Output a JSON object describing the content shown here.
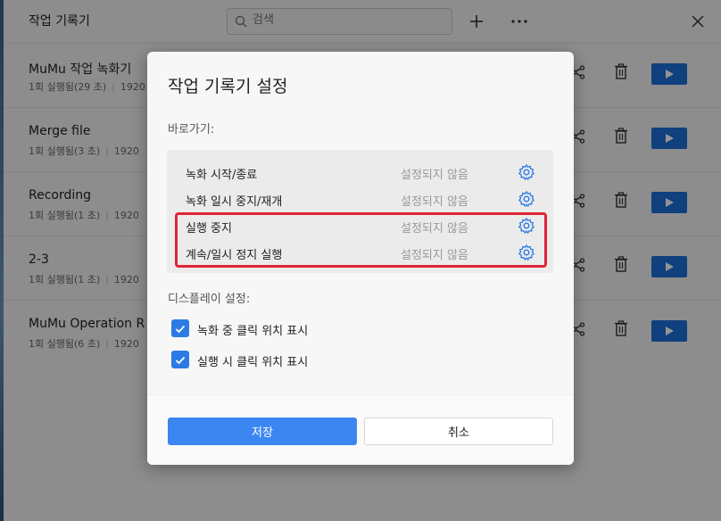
{
  "app": {
    "title": "작업 기록기",
    "search_placeholder": "검색"
  },
  "records": [
    {
      "title": "MuMu 작업 녹화기",
      "runs": "1회 실행됨(29 초)",
      "resolution": "1920"
    },
    {
      "title": "Merge file",
      "runs": "1회 실행됨(3 초)",
      "resolution": "1920"
    },
    {
      "title": "Recording",
      "runs": "1회 실행됨(1 초)",
      "resolution": "1920"
    },
    {
      "title": "2-3",
      "runs": "1회 실행됨(1 초)",
      "resolution": "1920"
    },
    {
      "title": "MuMu Operation R",
      "runs": "1회 실행됨(6 초)",
      "resolution": "1920"
    }
  ],
  "dialog": {
    "title": "작업 기록기 설정",
    "shortcuts_label": "바로가기:",
    "shortcuts": [
      {
        "label": "녹화 시작/종료",
        "value": "설정되지 않음"
      },
      {
        "label": "녹화 일시 중지/재개",
        "value": "설정되지 않음"
      },
      {
        "label": "실행 중지",
        "value": "설정되지 않음"
      },
      {
        "label": "계속/일시 정지 실행",
        "value": "설정되지 않음"
      }
    ],
    "display_label": "디스플레이 설정:",
    "display_options": [
      {
        "label": "녹화 중 클릭 위치 표시",
        "checked": true
      },
      {
        "label": "실행 시 클릭 위치 표시",
        "checked": true
      }
    ],
    "save_label": "저장",
    "cancel_label": "취소"
  },
  "colors": {
    "accent": "#3b86f0",
    "play_button": "#1d6fd8",
    "highlight": "#e0243a"
  }
}
